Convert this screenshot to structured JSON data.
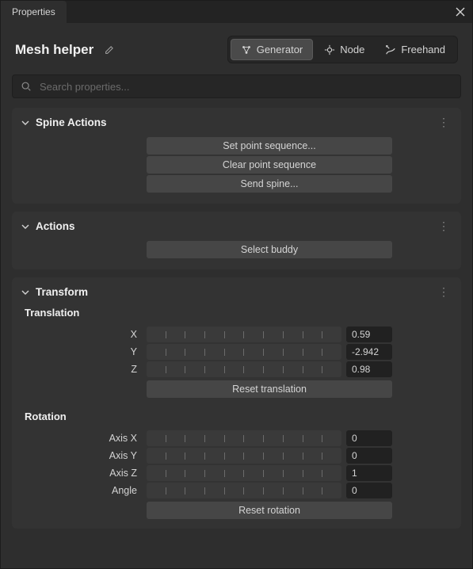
{
  "tab": {
    "title": "Properties"
  },
  "header": {
    "title": "Mesh helper",
    "modes": [
      {
        "label": "Generator",
        "active": true
      },
      {
        "label": "Node",
        "active": false
      },
      {
        "label": "Freehand",
        "active": false
      }
    ]
  },
  "search": {
    "placeholder": "Search properties..."
  },
  "sections": {
    "spine": {
      "title": "Spine Actions",
      "buttons": [
        "Set point sequence...",
        "Clear point sequence",
        "Send spine..."
      ]
    },
    "actions": {
      "title": "Actions",
      "buttons": [
        "Select buddy"
      ]
    },
    "transform": {
      "title": "Transform",
      "translation": {
        "label": "Translation",
        "fields": [
          {
            "label": "X",
            "value": "0.59"
          },
          {
            "label": "Y",
            "value": "-2.942"
          },
          {
            "label": "Z",
            "value": "0.98"
          }
        ],
        "reset": "Reset translation"
      },
      "rotation": {
        "label": "Rotation",
        "fields": [
          {
            "label": "Axis X",
            "value": "0"
          },
          {
            "label": "Axis Y",
            "value": "0"
          },
          {
            "label": "Axis Z",
            "value": "1"
          },
          {
            "label": "Angle",
            "value": "0"
          }
        ],
        "reset": "Reset rotation"
      }
    }
  }
}
